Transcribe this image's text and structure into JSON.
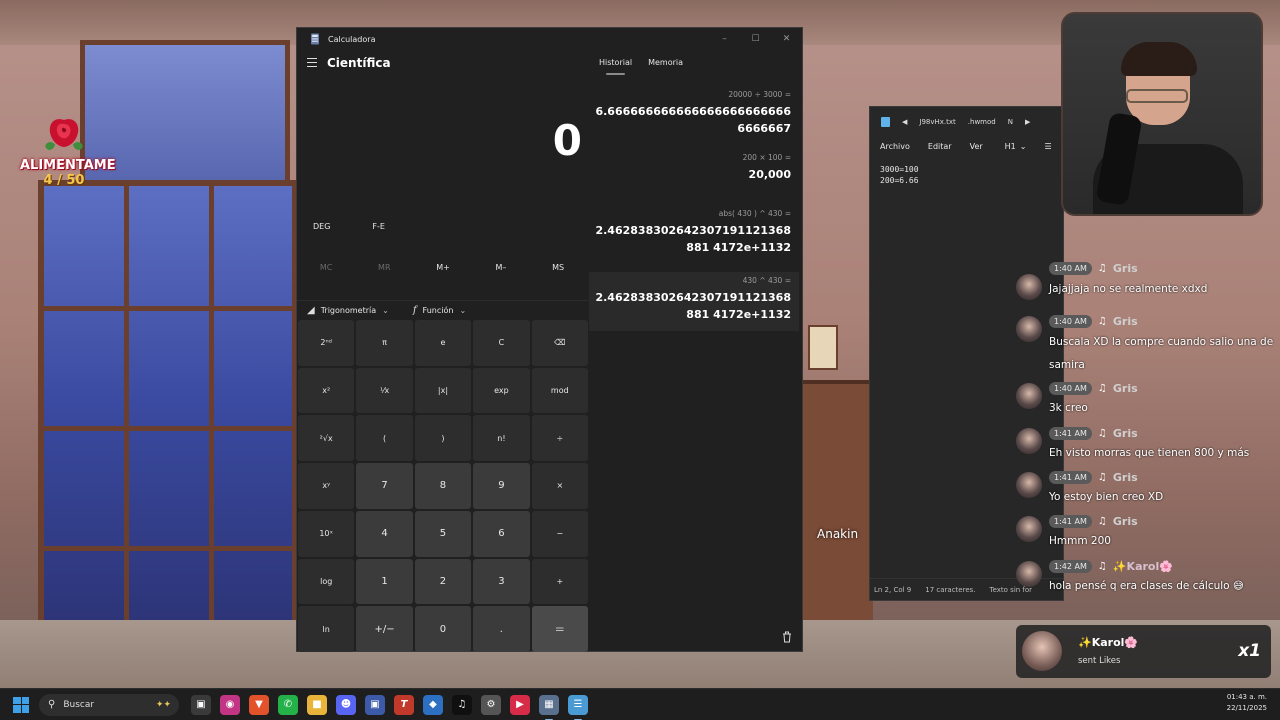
{
  "overlay": {
    "goal_label": "ALIMENTAME",
    "goal_count": "4 / 50"
  },
  "calculator": {
    "window_title": "Calculadora",
    "mode": "Científica",
    "display": "0",
    "angle_unit": "DEG",
    "notation": "F-E",
    "memory_buttons": [
      "MC",
      "MR",
      "M+",
      "M–",
      "MS"
    ],
    "trig_label": "Trigonometría",
    "func_label": "Función",
    "tabs": [
      "Historial",
      "Memoria"
    ],
    "keys": [
      [
        "2ⁿᵈ",
        "π",
        "e",
        "C",
        "⌫"
      ],
      [
        "x²",
        "¹⁄x",
        "|x|",
        "exp",
        "mod"
      ],
      [
        "²√x",
        "(",
        ")",
        "n!",
        "÷"
      ],
      [
        "xʸ",
        "7",
        "8",
        "9",
        "×"
      ],
      [
        "10ˣ",
        "4",
        "5",
        "6",
        "−"
      ],
      [
        "log",
        "1",
        "2",
        "3",
        "+"
      ],
      [
        "ln",
        "+/−",
        "0",
        ".",
        "="
      ]
    ],
    "history": [
      {
        "expr": "20000  ÷  3000 =",
        "result": "6.6666666666666666666666666666667"
      },
      {
        "expr": "200  ×  100 =",
        "result": "20,000"
      },
      {
        "expr": "abs( 430 )  ^  430 =",
        "result": "2.462838302642307191121368881 4172e+1132"
      },
      {
        "expr": "430  ^  430 =",
        "result": "2.462838302642307191121368881 4172e+1132"
      }
    ]
  },
  "notepad": {
    "tab1": "J98vHx.txt",
    "tab2": ".hwmod",
    "tab3": "N",
    "menu": [
      "Archivo",
      "Editar",
      "Ver",
      "H1"
    ],
    "content": "3000=100\n200=6.66",
    "status": [
      "Ln 2, Col 9",
      "17 caracteres.",
      "Texto sin for"
    ]
  },
  "chat": {
    "messages": [
      {
        "time": "1:40 AM",
        "user": "Gris",
        "text": "Jajajjaja no se realmente xdxd"
      },
      {
        "time": "1:40 AM",
        "user": "Gris",
        "text": "Buscala XD la compre cuando salio una de samira"
      },
      {
        "time": "1:40 AM",
        "user": "Gris",
        "text": "3k creo"
      },
      {
        "time": "1:41 AM",
        "user": "Gris",
        "text": "Eh visto morras que tienen 800 y más"
      },
      {
        "time": "1:41 AM",
        "user": "Gris",
        "text": "Yo estoy bien creo XD"
      },
      {
        "time": "1:41 AM",
        "user": "Gris",
        "text": "Hmmm 200"
      },
      {
        "time": "1:42 AM",
        "user": "✨Karol🌸",
        "text": "hola pensé q era clases de cálculo 😅"
      }
    ],
    "gift": {
      "user": "✨Karol🌸",
      "action": "sent Likes",
      "multiplier": "x1"
    }
  },
  "scene_label": "Anakin",
  "taskbar": {
    "search_placeholder": "Buscar",
    "time": "01:43 a. m.",
    "date": "22/11/2025"
  }
}
